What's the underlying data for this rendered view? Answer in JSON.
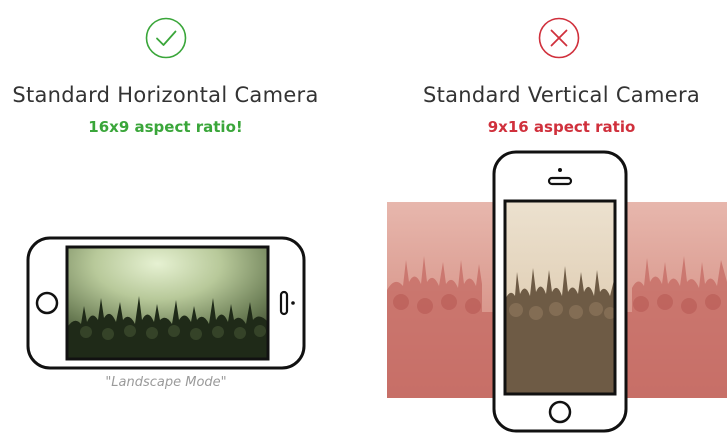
{
  "left_panel": {
    "status_icon": "check-circle-icon",
    "title": "Standard Horizontal Camera",
    "subtitle": "16x9 aspect ratio!",
    "caption": "\"Landscape Mode\""
  },
  "right_panel": {
    "status_icon": "x-circle-icon",
    "title": "Standard Vertical Camera",
    "subtitle": "9x16 aspect ratio"
  },
  "colors": {
    "good": "#3aa63a",
    "bad": "#d0303c",
    "phone_outline": "#111111",
    "title_text": "#333333",
    "caption_text": "#9a9a9a"
  }
}
